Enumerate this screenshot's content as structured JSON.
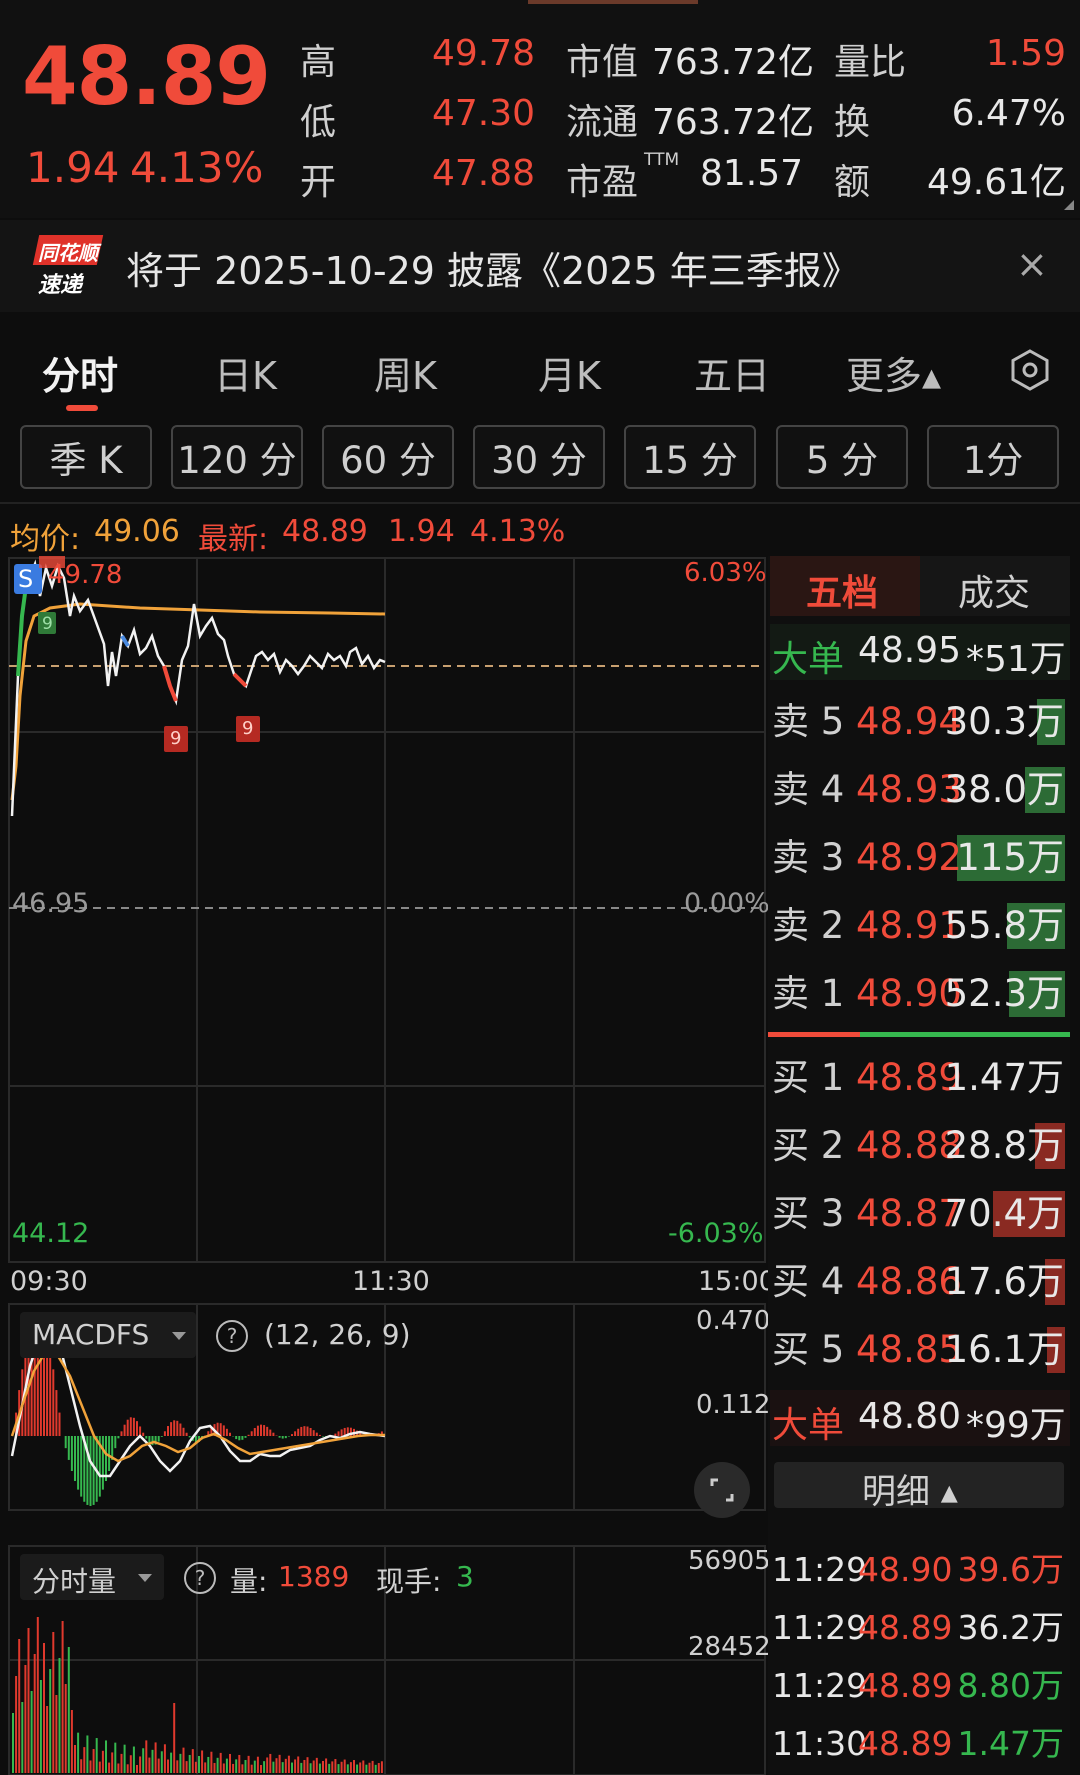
{
  "header": {
    "price": "48.89",
    "change": "1.94",
    "change_pct": "4.13%",
    "high_label": "高",
    "high": "49.78",
    "low_label": "低",
    "low": "47.30",
    "open_label": "开",
    "open": "47.88",
    "mktcap_label": "市值",
    "mktcap": "763.72亿",
    "float_label": "流通",
    "float": "763.72亿",
    "pe_label": "市盈",
    "pe_sup": "TTM",
    "pe": "81.57",
    "volratio_label": "量比",
    "volratio": "1.59",
    "turnover_label": "换",
    "turnover": "6.47%",
    "amount_label": "额",
    "amount": "49.61亿"
  },
  "notice": {
    "logo_top": "同花顺",
    "logo_bottom": "速递",
    "text": "将于 2025-10-29 披露《2025 年三季报》",
    "close": "×"
  },
  "tabs": {
    "items": [
      "分时",
      "日K",
      "周K",
      "月K",
      "五日",
      "更多▴"
    ],
    "active": "分时"
  },
  "periods": [
    "季 K",
    "120 分",
    "60 分",
    "30 分",
    "15 分",
    "5 分",
    "1分"
  ],
  "info": {
    "avg_label": "均价:",
    "avg": "49.06",
    "last_label": "最新:",
    "last": "48.89",
    "chg": "1.94",
    "pct": "4.13%"
  },
  "chart": {
    "y_top_pct": "6.03%",
    "y_mid": "46.95",
    "y_mid_pct": "0.00%",
    "y_bot": "44.12",
    "y_bot_pct": "-6.03%",
    "y_top_price_partial": "49.78",
    "t_start": "09:30",
    "t_mid": "11:30",
    "t_end": "15:00",
    "marker_s": "S",
    "marker_9a": "9",
    "marker_9b": "9",
    "marker_9c": "9"
  },
  "macd": {
    "name": "MACDFS",
    "params": "(12, 26, 9)",
    "y_top": "0.470",
    "y_mid": "0.112"
  },
  "volume": {
    "name": "分时量",
    "vol_label": "量:",
    "vol": "1389",
    "hand_label": "现手:",
    "hand": "3",
    "y_top": "56905",
    "y_mid": "28452"
  },
  "orderbook": {
    "tab_active": "五档",
    "tab_other": "成交",
    "big_sell_label": "大单",
    "big_sell_price": "48.95",
    "big_sell_vol": "*51万",
    "asks": [
      {
        "label": "卖 5",
        "price": "48.94",
        "vol": "30.3万"
      },
      {
        "label": "卖 4",
        "price": "48.93",
        "vol": "38.0万"
      },
      {
        "label": "卖 3",
        "price": "48.92",
        "vol": "115万"
      },
      {
        "label": "卖 2",
        "price": "48.91",
        "vol": "55.8万"
      },
      {
        "label": "卖 1",
        "price": "48.90",
        "vol": "52.3万"
      }
    ],
    "bids": [
      {
        "label": "买 1",
        "price": "48.89",
        "vol": "1.47万"
      },
      {
        "label": "买 2",
        "price": "48.88",
        "vol": "28.8万"
      },
      {
        "label": "买 3",
        "price": "48.87",
        "vol": "70.4万"
      },
      {
        "label": "买 4",
        "price": "48.86",
        "vol": "17.6万"
      },
      {
        "label": "买 5",
        "price": "48.85",
        "vol": "16.1万"
      }
    ],
    "big_buy_label": "大单",
    "big_buy_price": "48.80",
    "big_buy_vol": "*99万",
    "detail_label": "明细 ▴",
    "trades": [
      {
        "time": "11:29",
        "price": "48.90",
        "vol": "39.6万"
      },
      {
        "time": "11:29",
        "price": "48.89",
        "vol": "36.2万"
      },
      {
        "time": "11:29",
        "price": "48.89",
        "vol": "8.80万"
      },
      {
        "time": "11:30",
        "price": "48.89",
        "vol": "1.47万"
      }
    ]
  },
  "colors": {
    "up": "#f04b3a",
    "down": "#36b84f",
    "avg": "#f0a23a",
    "bg": "#0d0d0d"
  }
}
